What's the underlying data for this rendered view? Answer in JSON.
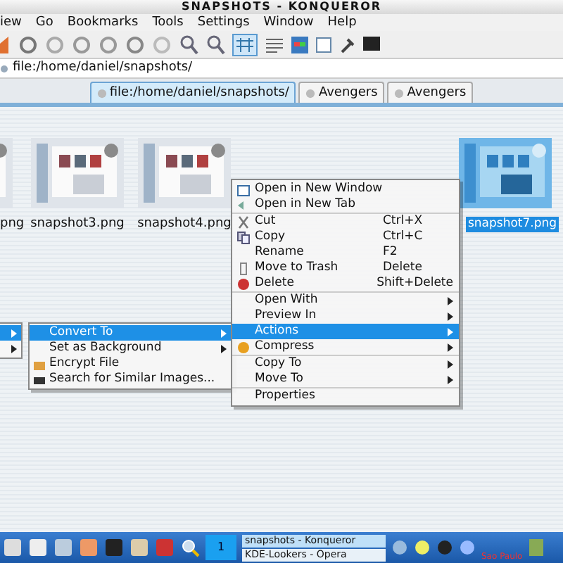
{
  "window": {
    "title": "SNAPSHOTS - KONQUEROR"
  },
  "menubar": [
    "iew",
    "Go",
    "Bookmarks",
    "Tools",
    "Settings",
    "Window",
    "Help"
  ],
  "location": {
    "value": "file:/home/daniel/snapshots/"
  },
  "tabs": [
    {
      "label": "file:/home/daniel/snapshots/",
      "selected": true
    },
    {
      "label": "Avengers",
      "selected": false
    },
    {
      "label": "Avengers",
      "selected": false
    }
  ],
  "files": [
    {
      "name": "png",
      "selected": false
    },
    {
      "name": "snapshot3.png",
      "selected": false
    },
    {
      "name": "snapshot4.png",
      "selected": false
    },
    {
      "name": "snapshot7.png",
      "selected": true
    }
  ],
  "context_menu": {
    "sections": [
      [
        {
          "label": "Open in New Window",
          "selected": false,
          "submenu": false
        },
        {
          "label": "Open in New Tab",
          "selected": false,
          "submenu": false
        }
      ],
      [
        {
          "label": "Cut",
          "shortcut": "Ctrl+X",
          "selected": false,
          "submenu": false
        },
        {
          "label": "Copy",
          "shortcut": "Ctrl+C",
          "selected": false,
          "submenu": false
        },
        {
          "label": "Rename",
          "shortcut": "F2",
          "selected": false,
          "submenu": false
        },
        {
          "label": "Move to Trash",
          "shortcut": "Delete",
          "selected": false,
          "submenu": false
        },
        {
          "label": "Delete",
          "shortcut": "Shift+Delete",
          "selected": false,
          "submenu": false
        }
      ],
      [
        {
          "label": "Open With",
          "selected": false,
          "submenu": true
        },
        {
          "label": "Preview In",
          "selected": false,
          "submenu": true
        },
        {
          "label": "Actions",
          "selected": true,
          "submenu": true
        },
        {
          "label": "Compress",
          "selected": false,
          "submenu": true
        }
      ],
      [
        {
          "label": "Copy To",
          "selected": false,
          "submenu": true
        },
        {
          "label": "Move To",
          "selected": false,
          "submenu": true
        }
      ],
      [
        {
          "label": "Properties",
          "selected": false,
          "submenu": false
        }
      ]
    ]
  },
  "actions_menu": [
    {
      "label": "Convert To",
      "selected": true,
      "submenu": true
    },
    {
      "label": "Set as Background",
      "selected": false,
      "submenu": true
    },
    {
      "label": "Encrypt File",
      "selected": false,
      "submenu": false
    },
    {
      "label": "Search for Similar Images...",
      "selected": false,
      "submenu": false
    }
  ],
  "left_menu": [
    {
      "selected": true,
      "submenu": true
    },
    {
      "selected": false,
      "submenu": true
    }
  ],
  "taskbar": {
    "tasks": [
      {
        "label": "snapshots - Konqueror",
        "selected": true
      },
      {
        "label": "KDE-Lookers - Opera",
        "selected": false
      }
    ],
    "desktop": "1",
    "clock_city": "Sao Paulo"
  }
}
